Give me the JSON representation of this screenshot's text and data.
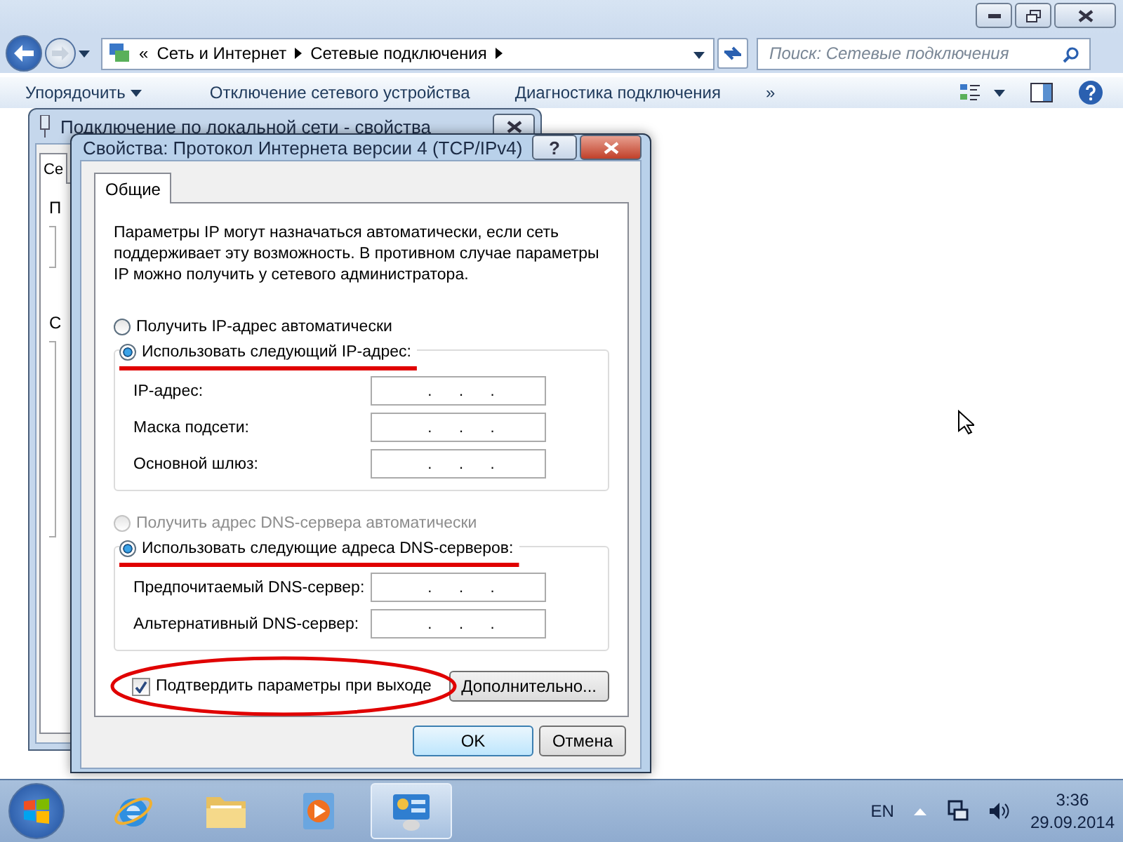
{
  "explorer": {
    "breadcrumb_lead": "«",
    "breadcrumb": [
      "Сеть и Интернет",
      "Сетевые подключения"
    ],
    "search": {
      "placeholder": "Поиск: Сетевые подключения"
    },
    "toolbar": [
      {
        "label": "Упорядочить",
        "dropdown": true
      },
      {
        "label": "Отключение сетевого устройства",
        "dropdown": false
      },
      {
        "label": "Диагностика подключения",
        "dropdown": false
      }
    ],
    "overflow": "»"
  },
  "back_dialog": {
    "title": "Подключение по локальной сети - свойства",
    "tab": "Се",
    "fragments": [
      "П",
      "С"
    ]
  },
  "dialog": {
    "title": "Свойства: Протокол Интернета версии 4 (TCP/IPv4)",
    "help": "?",
    "tabs": [
      {
        "label": "Общие",
        "selected": true
      }
    ],
    "intro": "Параметры IP могут назначаться автоматически, если сеть поддерживает эту возможность. В противном случае параметры IP можно получить у сетевого администратора.",
    "ip_options": [
      {
        "label": "Получить IP-адрес автоматически",
        "selected": false,
        "disabled": false
      },
      {
        "label": "Использовать следующий IP-адрес:",
        "selected": true,
        "disabled": false
      }
    ],
    "ip_fields": [
      {
        "label": "IP-адрес:"
      },
      {
        "label": "Маска подсети:"
      },
      {
        "label": "Основной шлюз:"
      }
    ],
    "dns_options": [
      {
        "label": "Получить адрес DNS-сервера автоматически",
        "selected": false,
        "disabled": true
      },
      {
        "label": "Использовать следующие адреса DNS-серверов:",
        "selected": true,
        "disabled": false
      }
    ],
    "dns_fields": [
      {
        "label": "Предпочитаемый DNS-сервер:"
      },
      {
        "label": "Альтернативный DNS-сервер:"
      }
    ],
    "separator": ".",
    "validate": {
      "label": "Подтвердить параметры при выходе",
      "checked": true
    },
    "advanced": "Дополнительно...",
    "buttons": [
      {
        "label": "OK",
        "default": true
      },
      {
        "label": "Отмена",
        "default": false
      }
    ]
  },
  "taskbar": {
    "apps": [
      {
        "kind": "browser",
        "selected": false
      },
      {
        "kind": "folder",
        "selected": false
      },
      {
        "kind": "media",
        "selected": false
      },
      {
        "kind": "control-panel",
        "selected": true
      }
    ],
    "language": "EN",
    "time": "3:36",
    "date": "29.09.2014"
  }
}
